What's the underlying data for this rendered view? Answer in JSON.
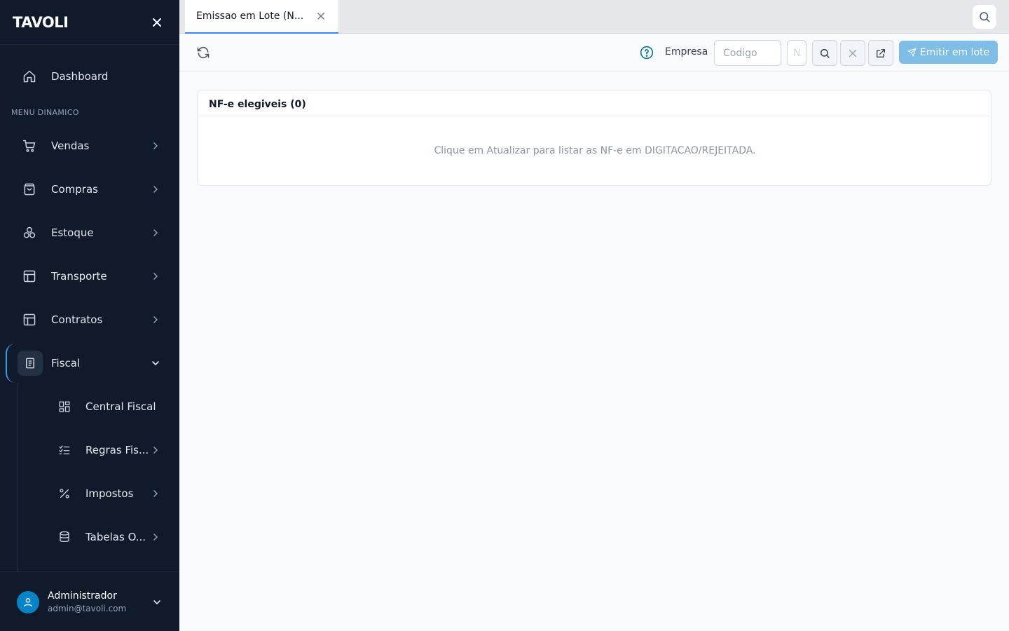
{
  "brand": {
    "logo_text": "TAVOLI"
  },
  "sidebar": {
    "dashboard_label": "Dashboard",
    "section_label": "MENU DINAMICO",
    "items": [
      {
        "label": "Vendas",
        "icon": "cart-icon"
      },
      {
        "label": "Compras",
        "icon": "shopping-bag-icon"
      },
      {
        "label": "Estoque",
        "icon": "boxes-icon"
      },
      {
        "label": "Transporte",
        "icon": "layout-icon"
      },
      {
        "label": "Contratos",
        "icon": "layout-icon"
      },
      {
        "label": "Fiscal",
        "icon": "document-icon",
        "expanded": true
      }
    ],
    "fiscal_subitems": [
      {
        "label": "Central Fiscal",
        "icon": "grid-icon"
      },
      {
        "label": "Regras Fis...",
        "icon": "checklist-icon"
      },
      {
        "label": "Impostos",
        "icon": "percent-icon"
      },
      {
        "label": "Tabelas O...",
        "icon": "database-icon"
      }
    ]
  },
  "user": {
    "name": "Administrador",
    "email": "admin@tavoli.com"
  },
  "tabs": [
    {
      "label": "Emissao em Lote (N...",
      "active": true
    }
  ],
  "toolbar": {
    "empresa_label": "Empresa",
    "codigo_placeholder": "Codigo",
    "name_placeholder": "N",
    "emit_label": "Emitir em lote"
  },
  "card": {
    "title": "NF-e elegiveis (0)",
    "empty_message": "Clique em Atualizar para listar as NF-e em DIGITACAO/REJEITADA."
  },
  "colors": {
    "sidebar_bg": "#111a2b",
    "accent": "#3b82f6",
    "emit_button": "#7dbde6",
    "avatar": "#0284c7"
  }
}
